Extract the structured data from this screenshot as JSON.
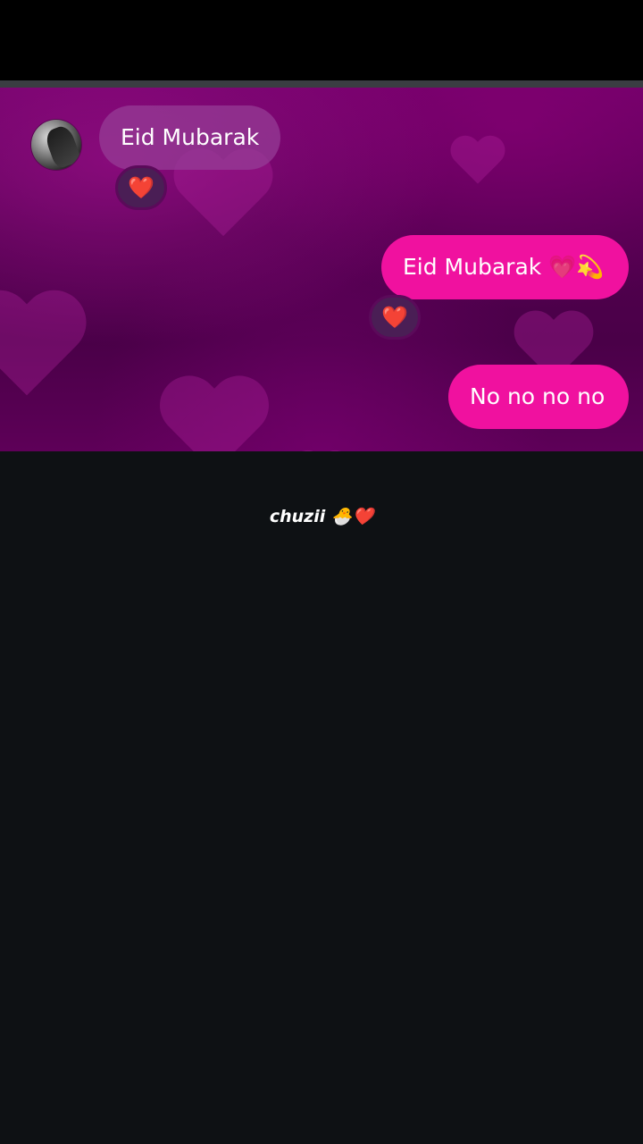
{
  "chat": {
    "messages": [
      {
        "from": "other",
        "text": "Eid Mubarak",
        "reaction": "❤️"
      },
      {
        "from": "me",
        "text": "Eid Mubarak 💗💫",
        "reaction": "❤️"
      },
      {
        "from": "me",
        "text": "No no no no"
      }
    ]
  },
  "caption": {
    "text": "chuzii 🐣❤️"
  },
  "colors": {
    "incoming_bubble": "#963c96",
    "outgoing_bubble": "#f0119f",
    "chat_background": "#52004f",
    "page_background": "#0e1114",
    "reaction_heart": "#e01e2f"
  }
}
